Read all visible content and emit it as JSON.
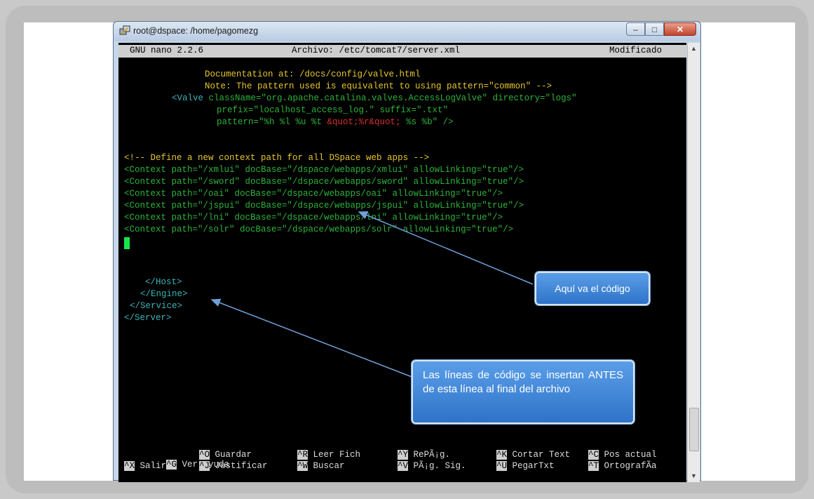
{
  "window": {
    "title": "root@dspace: /home/pagomezg",
    "buttons": {
      "minimize": "–",
      "maximize": "□",
      "close": "✕"
    }
  },
  "nano": {
    "version": "GNU nano 2.2.6",
    "file": "Archivo: /etc/tomcat7/server.xml",
    "status": "Modificado"
  },
  "code": {
    "l1": "Documentation at: /docs/config/valve.html",
    "l2": "Note: The pattern used is equivalent to using pattern=\"common\" -->",
    "l3a": "<Valve ",
    "l3b": "className=\"org.apache.catalina.valves.AccessLogValve\" directory=\"logs\"",
    "l4": "prefix=\"localhost_access_log.\" suffix=\".txt\"",
    "l5a": "pattern=\"%h %l %u %t ",
    "l5b": "&quot;%r&quot;",
    "l5c": " %s %b\" />",
    "comment": "<!-- Define a new context path for all DSpace web apps -->",
    "ctx1": "<Context path=\"/xmlui\" docBase=\"/dspace/webapps/xmlui\" allowLinking=\"true\"/>",
    "ctx2": "<Context path=\"/sword\" docBase=\"/dspace/webapps/sword\" allowLinking=\"true\"/>",
    "ctx3": "<Context path=\"/oai\" docBase=\"/dspace/webapps/oai\" allowLinking=\"true\"/>",
    "ctx4": "<Context path=\"/jspui\" docBase=\"/dspace/webapps/jspui\" allowLinking=\"true\"/>",
    "ctx5": "<Context path=\"/lni\" docBase=\"/dspace/webapps/lni\" allowLinking=\"true\"/>",
    "ctx6": "<Context path=\"/solr\" docBase=\"/dspace/webapps/solr\" allowLinking=\"true\"/>",
    "host": "</Host>",
    "engine": "</Engine>",
    "service": "</Service>",
    "server": "</Server>"
  },
  "shortcuts": {
    "row1": [
      {
        "key": "^G",
        "label": "Ver ayuda"
      },
      {
        "key": "^O",
        "label": "Guardar"
      },
      {
        "key": "^R",
        "label": "Leer Fich"
      },
      {
        "key": "^Y",
        "label": "RePÃ¡g."
      },
      {
        "key": "^K",
        "label": "Cortar Text"
      },
      {
        "key": "^C",
        "label": "Pos actual"
      }
    ],
    "row2": [
      {
        "key": "^X",
        "label": "Salir"
      },
      {
        "key": "^J",
        "label": "Justificar"
      },
      {
        "key": "^W",
        "label": "Buscar"
      },
      {
        "key": "^V",
        "label": "PÃ¡g. Sig."
      },
      {
        "key": "^U",
        "label": "PegarTxt"
      },
      {
        "key": "^T",
        "label": "OrtografÃ­a"
      }
    ]
  },
  "callouts": {
    "c1": "Aquí va el código",
    "c2": "Las líneas de código se insertan ANTES de esta línea al final del archivo"
  },
  "colors": {
    "terminal_bg": "#000000",
    "comment_yellow": "#e6c62f",
    "tag_green": "#2db33a",
    "tag_cyan": "#3bb3b8",
    "callout_blue": "#3f84d6"
  }
}
